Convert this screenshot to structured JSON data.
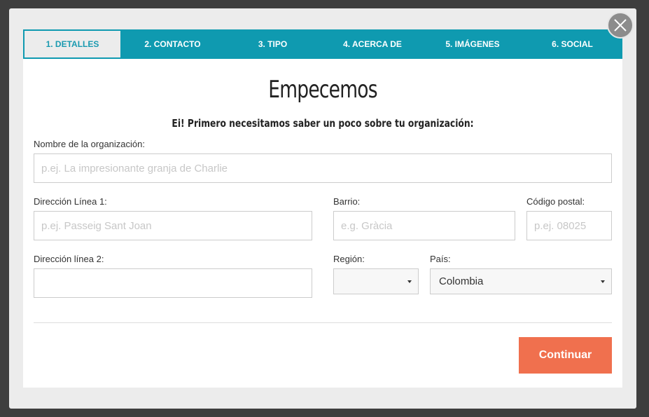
{
  "tabs": [
    {
      "label": "1. DETALLES"
    },
    {
      "label": "2. CONTACTO"
    },
    {
      "label": "3. TIPO"
    },
    {
      "label": "4. ACERCA DE"
    },
    {
      "label": "5. IMÁGENES"
    },
    {
      "label": "6. SOCIAL"
    }
  ],
  "heading": {
    "title": "Empecemos",
    "subtitle": "Ei! Primero necesitamos saber un poco sobre tu organización:"
  },
  "form": {
    "org_name": {
      "label": "Nombre de la organización:",
      "placeholder": "p.ej. La impresionante granja de Charlie",
      "value": ""
    },
    "address1": {
      "label": "Dirección Línea 1:",
      "placeholder": "p.ej. Passeig Sant Joan",
      "value": ""
    },
    "neighborhood": {
      "label": "Barrio:",
      "placeholder": "e.g. Gràcia",
      "value": ""
    },
    "postal": {
      "label": "Código postal:",
      "placeholder": "p.ej. 08025",
      "value": ""
    },
    "address2": {
      "label": "Dirección línea 2:",
      "placeholder": "",
      "value": ""
    },
    "region": {
      "label": "Región:",
      "value": ""
    },
    "country": {
      "label": "País:",
      "value": "Colombia"
    }
  },
  "actions": {
    "continue_label": "Continuar"
  },
  "colors": {
    "tab_bar": "#0f9ab0",
    "active_tab_bg": "#ececec",
    "continue_button": "#f0704e",
    "overlay": "#3e3e3e"
  },
  "icons": {
    "close": "close-icon",
    "dropdown": "chevron-down-icon"
  }
}
